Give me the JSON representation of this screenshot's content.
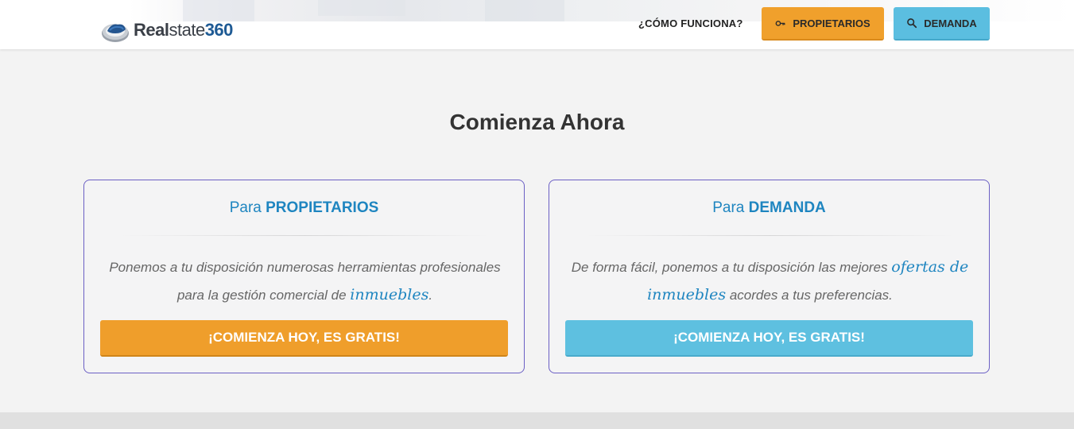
{
  "header": {
    "logo": {
      "part1": "Real",
      "part2": "state",
      "part3": "360"
    },
    "nav_link": "¿CÓMO FUNCIONA?",
    "btn_propietarios": {
      "label": "PROPIETARIOS",
      "icon": "key-icon"
    },
    "btn_demanda": {
      "label": "DEMANDA",
      "icon": "search-icon"
    }
  },
  "main": {
    "title": "Comienza Ahora",
    "cards": [
      {
        "title_prefix": "Para ",
        "title_strong": "PROPIETARIOS",
        "text_before": "Ponemos a tu disposición numerosas herramientas profesionales para la gestión comercial de ",
        "text_highlight": "inmuebles",
        "text_after": ".",
        "button": "¡COMIENZA HOY, ES GRATIS!"
      },
      {
        "title_prefix": "Para ",
        "title_strong": "DEMANDA",
        "text_before": "De forma fácil, ponemos a tu disposición las mejores ",
        "text_highlight": "ofertas de inmuebles",
        "text_after": " acordes a tus preferencias.",
        "button": "¡COMIENZA HOY, ES GRATIS!"
      }
    ]
  },
  "colors": {
    "orange": "#ef9e2b",
    "blue": "#5ec0e0",
    "accent_text": "#1e85c0",
    "card_border": "#6b5fc4"
  }
}
